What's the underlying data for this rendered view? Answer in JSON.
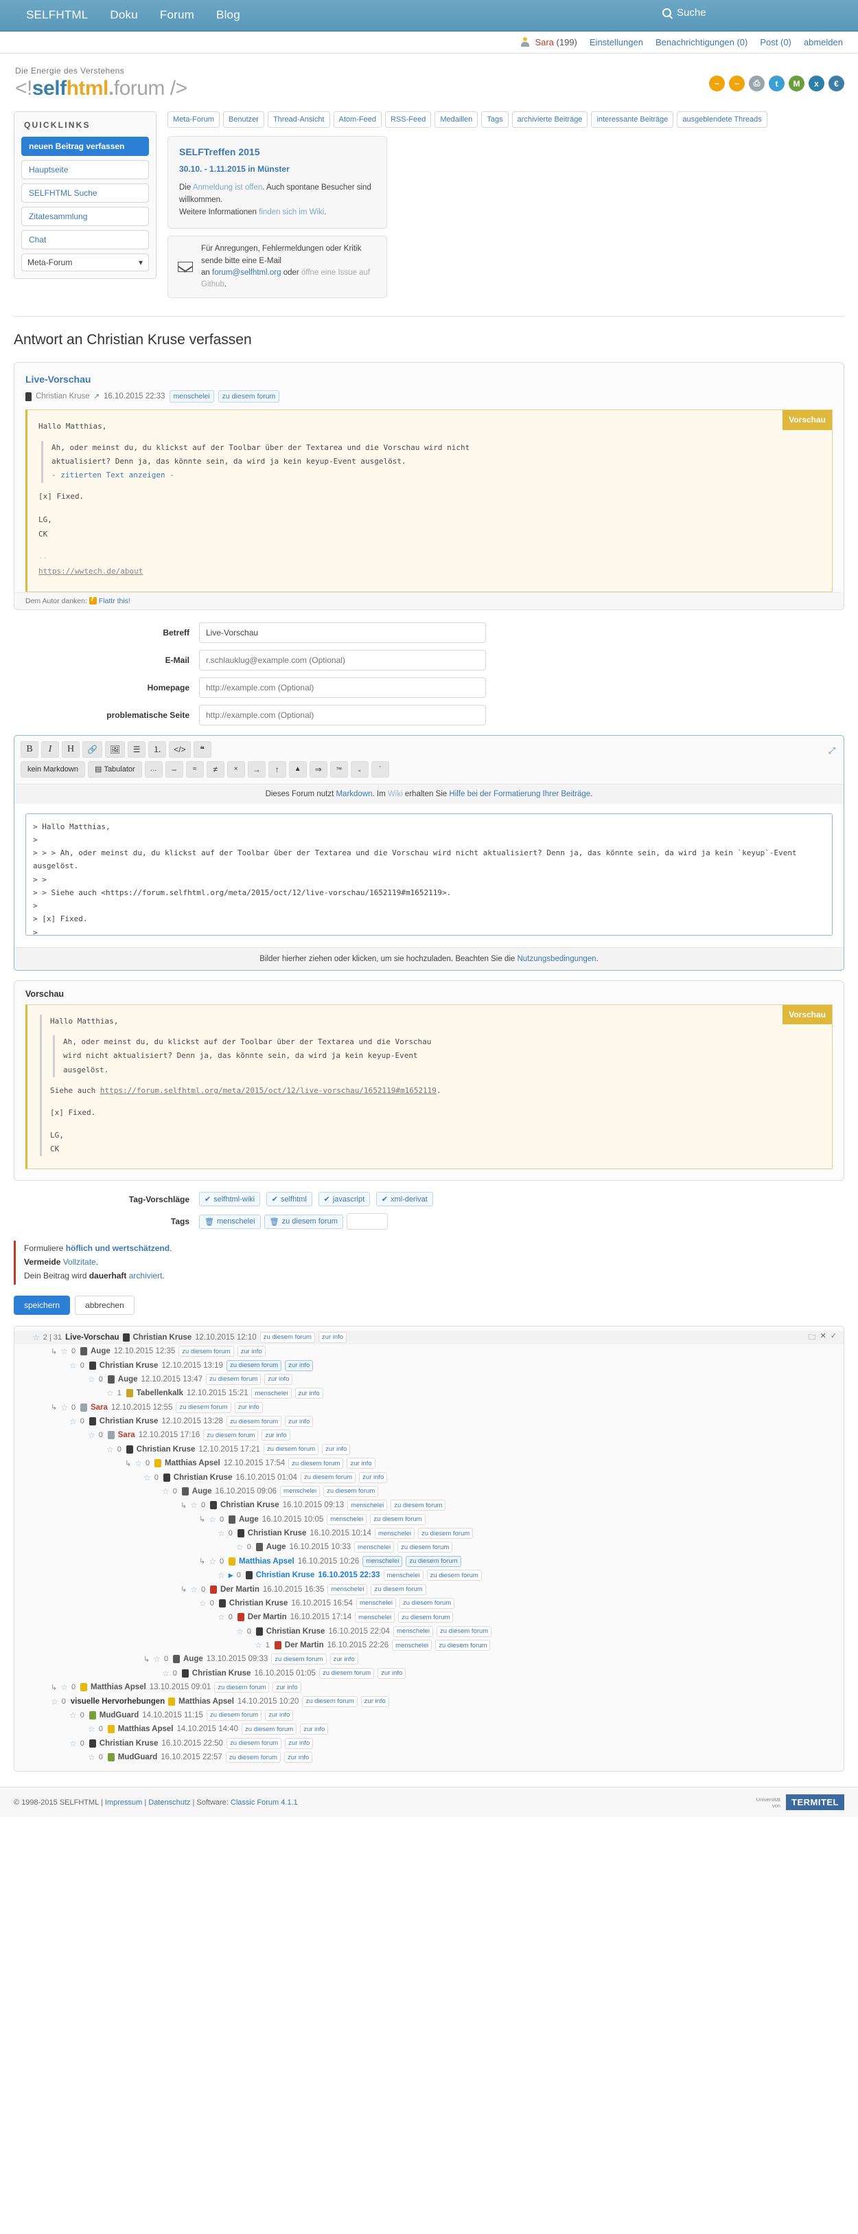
{
  "topnav": {
    "items": [
      "SELFHTML",
      "Doku",
      "Forum",
      "Blog"
    ],
    "search_label": "Suche",
    "search_icon": "search-icon"
  },
  "userbar": {
    "user_name": "Sara",
    "user_count": "(199)",
    "links": [
      "Einstellungen",
      "Benachrichtigungen (0)",
      "Post (0)",
      "abmelden"
    ]
  },
  "brand": {
    "tagline": "Die Energie des Verstehens",
    "logo_open": "<!",
    "logo_self": "self",
    "logo_html": "html",
    "logo_dot": ".",
    "logo_forum": "forum />",
    "social_icons": [
      "rss-icon",
      "rss-alt-icon",
      "print-icon",
      "twitter-icon",
      "mastodon-icon",
      "xing-icon",
      "euro-icon"
    ],
    "colors": {
      "self": "#3c7ea6",
      "html": "#e8a92b",
      "accent": "#2b7fd4"
    }
  },
  "sidebar": {
    "title": "QUICKLINKS",
    "primary": "neuen Beitrag verfassen",
    "items": [
      "Hauptseite",
      "SELFHTML Suche",
      "Zitatesammlung",
      "Chat"
    ],
    "select_value": "Meta-Forum"
  },
  "forum_tabs": [
    "Meta-Forum",
    "Benutzer",
    "Thread-Ansicht",
    "Atom-Feed",
    "RSS-Feed",
    "Medaillen",
    "Tags",
    "archivierte Beiträge",
    "interessante Beiträge",
    "ausgeblendete Threads"
  ],
  "notice": {
    "title": "SELFTreffen 2015",
    "when": "30.10. - 1.11.2015 in Münster",
    "line1_a": "Die ",
    "line1_link": "Anmeldung ist offen",
    "line1_b": ". Auch spontane Besucher sind willkommen.",
    "line2_a": "Weitere Informationen ",
    "line2_link": "finden sich im Wiki",
    "line2_b": "."
  },
  "mailbox": {
    "icon": "envelope-icon",
    "line1": "Für Anregungen, Fehlermeldungen oder Kritik sende bitte eine E-Mail",
    "line2_a": "an ",
    "line2_mail": "forum@selfhtml.org",
    "line2_b": " oder ",
    "line2_link": "öffne eine Issue auf Github",
    "line2_c": "."
  },
  "reply": {
    "heading": "Antwort an Christian Kruse verfassen"
  },
  "quoted_post": {
    "subject": "Live-Vorschau",
    "author": "Christian Kruse",
    "author_icon": "avatar-icon",
    "external_icon": "external-link-icon",
    "timestamp": "16.10.2015 22:33",
    "tags": [
      "menschelei",
      "zu diesem forum"
    ],
    "badge": "Vorschau",
    "greeting": "Hallo Matthias,",
    "quote_l1": "Ah, oder meinst du, du klickst auf der Toolbar über der Textarea und die Vorschau wird nicht",
    "quote_l2": "aktualisiert? Denn ja, das könnte sein, da wird ja kein keyup-Event ausgelöst.",
    "quote_toggle": "- zitierten Text anzeigen -",
    "fixed": "[x] Fixed.",
    "sig1": "LG,",
    "sig2": "CK",
    "sig_dash": "--",
    "sig_url": "https://wwtech.de/about",
    "thanks_label": "Dem Autor danken:",
    "flattr_icon": "flattr-icon",
    "flattr_label": "Flattr this!"
  },
  "form": {
    "rows": [
      {
        "label": "Betreff",
        "value": "Live-Vorschau",
        "placeholder": ""
      },
      {
        "label": "E-Mail",
        "value": "",
        "placeholder": "r.schlauklug@example.com (Optional)"
      },
      {
        "label": "Homepage",
        "value": "",
        "placeholder": "http://example.com (Optional)"
      },
      {
        "label": "problematische Seite",
        "value": "",
        "placeholder": "http://example.com (Optional)"
      }
    ]
  },
  "toolbar": {
    "row1": [
      {
        "glyph": "B",
        "name": "bold-button"
      },
      {
        "glyph": "I",
        "name": "italic-button"
      },
      {
        "glyph": "H",
        "name": "heading-button"
      },
      {
        "glyph": "🔗",
        "name": "link-button"
      },
      {
        "glyph": "🖼",
        "name": "image-button"
      },
      {
        "glyph": "☰",
        "name": "unordered-list-button"
      },
      {
        "glyph": "⒈",
        "name": "ordered-list-button"
      },
      {
        "glyph": "</>",
        "name": "code-button"
      },
      {
        "glyph": "❝",
        "name": "quote-button"
      }
    ],
    "row2": [
      {
        "glyph": "kein Markdown",
        "name": "no-markdown-button",
        "wide": true
      },
      {
        "glyph": "Tabulator",
        "name": "tabulator-button",
        "wide": true
      },
      {
        "glyph": "…",
        "name": "ellipsis-button"
      },
      {
        "glyph": "–",
        "name": "endash-button"
      },
      {
        "glyph": "≈",
        "name": "approx-button"
      },
      {
        "glyph": "≠",
        "name": "notequal-button"
      },
      {
        "glyph": "×",
        "name": "times-button"
      },
      {
        "glyph": "→",
        "name": "arrow-right-button"
      },
      {
        "glyph": "↑",
        "name": "arrow-up-button"
      },
      {
        "glyph": "▲",
        "name": "triangle-up-button"
      },
      {
        "glyph": "⇒",
        "name": "double-arrow-button"
      },
      {
        "glyph": "™",
        "name": "trademark-button"
      },
      {
        "glyph": "„",
        "name": "quote-low-button"
      },
      {
        "glyph": "’",
        "name": "apostrophe-button"
      }
    ],
    "expand_icon": "expand-icon",
    "markdown_note_a": "Dieses Forum nutzt ",
    "markdown_note_link1": "Markdown",
    "markdown_note_b": ". Im ",
    "markdown_note_link2": "Wiki",
    "markdown_note_c": " erhalten Sie ",
    "markdown_note_link3": "Hilfe bei der Formatierung Ihrer Beiträge",
    "markdown_note_d": "."
  },
  "textarea": {
    "value": "> Hallo Matthias,\n>\n> > > Ah, oder meinst du, du klickst auf der Toolbar über der Textarea und die Vorschau wird nicht aktualisiert? Denn ja, das könnte sein, da wird ja kein `keyup`-Event ausgelöst.\n> >\n> > Siehe auch <https://forum.selfhtml.org/meta/2015/oct/12/live-vorschau/1652119#m1652119>.\n>\n> [x] Fixed.\n>\n> LG,\n> CK\n>"
  },
  "dropzone": {
    "text_a": "Bilder hierher ziehen oder klicken, um sie hochzuladen. Beachten Sie die ",
    "link": "Nutzungsbedingungen",
    "text_b": "."
  },
  "preview": {
    "title": "Vorschau",
    "badge": "Vorschau",
    "greeting": "Hallo Matthias,",
    "quote_l1": "Ah, oder meinst du, du klickst auf der Toolbar über der Textarea und die Vorschau",
    "quote_l2": "wird nicht aktualisiert? Denn ja, das könnte sein, da wird ja kein keyup-Event",
    "quote_l3": "ausgelöst.",
    "quote_code": "keyup",
    "siehe_a": "Siehe auch ",
    "siehe_url": "https://forum.selfhtml.org/meta/2015/oct/12/live-vorschau/1652119#m1652119",
    "siehe_b": ".",
    "fixed": "[x] Fixed.",
    "sig1": "LG,",
    "sig2": "CK"
  },
  "tags_section": {
    "suggestions_label": "Tag-Vorschläge",
    "suggestions": [
      "selfhtml-wiki",
      "selfhtml",
      "javascript",
      "xml-derivat"
    ],
    "tags_label": "Tags",
    "tags": [
      "menschelei",
      "zu diesem forum"
    ],
    "new_tag_value": ""
  },
  "hints": {
    "l1_a": "Formuliere ",
    "l1_b": "höflich und wertschätzend",
    "l1_c": ".",
    "l2_a": "Vermeide ",
    "l2_b": "Vollzitate",
    "l2_c": ".",
    "l3_a": "Dein Beitrag wird ",
    "l3_b": "dauerhaft ",
    "l3_c": "archiviert",
    "l3_d": "."
  },
  "actions": {
    "save": "speichern",
    "cancel": "abbrechen"
  },
  "tree": {
    "controls": [
      "folder-icon",
      "close-icon",
      "check-icon"
    ],
    "rows": [
      {
        "indent": 0,
        "arrow": false,
        "star": "☆",
        "count": "2 | 31",
        "subject": "Live-Vorschau",
        "avatar": "av-ck",
        "author": "Christian Kruse",
        "time": "12.10.2015 12:10",
        "tags": [
          "zu diesem forum",
          "zur info"
        ],
        "head": true
      },
      {
        "indent": 1,
        "arrow": true,
        "star": "☆",
        "count": "0",
        "avatar": "av-auge",
        "author": "Auge",
        "time": "12.10.2015 12:35",
        "tags": [
          "zu diesem forum",
          "zur info"
        ]
      },
      {
        "indent": 2,
        "arrow": false,
        "star": "☆",
        "count": "0",
        "avatar": "av-ck",
        "author": "Christian Kruse",
        "time": "12.10.2015 13:19",
        "tags": [
          "zu diesem forum",
          "zur info"
        ],
        "hl": true
      },
      {
        "indent": 3,
        "arrow": false,
        "star": "☆",
        "count": "0",
        "avatar": "av-auge",
        "author": "Auge",
        "time": "12.10.2015 13:47",
        "tags": [
          "zu diesem forum",
          "zur info"
        ]
      },
      {
        "indent": 4,
        "arrow": false,
        "star": "☆",
        "count": "1",
        "avatar": "av-tab",
        "author": "Tabellenkalk",
        "time": "12.10.2015 15:21",
        "tags": [
          "menschelei",
          "zur info"
        ]
      },
      {
        "indent": 1,
        "arrow": true,
        "star": "☆",
        "count": "0",
        "avatar": "av-sara",
        "author": "Sara",
        "author_class": "sara",
        "time": "12.10.2015 12:55",
        "tags": [
          "zu diesem forum",
          "zur info"
        ]
      },
      {
        "indent": 2,
        "arrow": false,
        "star": "☆",
        "count": "0",
        "avatar": "av-ck",
        "author": "Christian Kruse",
        "time": "12.10.2015 13:28",
        "tags": [
          "zu diesem forum",
          "zur info"
        ]
      },
      {
        "indent": 3,
        "arrow": false,
        "star": "☆",
        "count": "0",
        "avatar": "av-sara",
        "author": "Sara",
        "author_class": "sara",
        "time": "12.10.2015 17:16",
        "tags": [
          "zu diesem forum",
          "zur info"
        ]
      },
      {
        "indent": 4,
        "arrow": false,
        "star": "☆",
        "count": "0",
        "avatar": "av-ck",
        "author": "Christian Kruse",
        "time": "12.10.2015 17:21",
        "tags": [
          "zu diesem forum",
          "zur info"
        ]
      },
      {
        "indent": 5,
        "arrow": true,
        "star": "☆",
        "count": "0",
        "avatar": "av-ma",
        "author": "Matthias Apsel",
        "time": "12.10.2015 17:54",
        "tags": [
          "zu diesem forum",
          "zur info"
        ]
      },
      {
        "indent": 6,
        "arrow": false,
        "star": "☆",
        "count": "0",
        "avatar": "av-ck",
        "author": "Christian Kruse",
        "time": "16.10.2015 01:04",
        "tags": [
          "zu diesem forum",
          "zur info"
        ]
      },
      {
        "indent": 7,
        "arrow": false,
        "star": "☆",
        "count": "0",
        "avatar": "av-auge",
        "author": "Auge",
        "time": "16.10.2015 09:06",
        "tags": [
          "menschelei",
          "zu diesem forum"
        ]
      },
      {
        "indent": 8,
        "arrow": true,
        "star": "☆",
        "count": "0",
        "avatar": "av-ck",
        "author": "Christian Kruse",
        "time": "16.10.2015 09:13",
        "tags": [
          "menschelei",
          "zu diesem forum"
        ]
      },
      {
        "indent": 9,
        "arrow": true,
        "star": "☆",
        "count": "0",
        "avatar": "av-auge",
        "author": "Auge",
        "time": "16.10.2015 10:05",
        "tags": [
          "menschelei",
          "zu diesem forum"
        ]
      },
      {
        "indent": 10,
        "arrow": false,
        "star": "☆",
        "count": "0",
        "avatar": "av-ck",
        "author": "Christian Kruse",
        "time": "16.10.2015 10:14",
        "tags": [
          "menschelei",
          "zu diesem forum"
        ]
      },
      {
        "indent": 11,
        "arrow": false,
        "star": "☆",
        "count": "0",
        "avatar": "av-auge",
        "author": "Auge",
        "time": "16.10.2015 10:33",
        "tags": [
          "menschelei",
          "zu diesem forum"
        ]
      },
      {
        "indent": 9,
        "arrow": true,
        "star": "☆",
        "count": "0",
        "avatar": "av-ma",
        "author": "Matthias Apsel",
        "author_class": "cur",
        "time": "16.10.2015 10:26",
        "tags": [
          "menschelei",
          "zu diesem forum"
        ],
        "hl": true
      },
      {
        "indent": 10,
        "arrow": false,
        "star": "☆",
        "tri": true,
        "count": "0",
        "avatar": "av-ck",
        "author": "Christian Kruse",
        "author_class": "cur",
        "time": "16.10.2015 22:33",
        "time_class": "cur",
        "tags": [
          "menschelei",
          "zu diesem forum"
        ]
      },
      {
        "indent": 8,
        "arrow": true,
        "star": "☆",
        "count": "0",
        "avatar": "av-dm",
        "author": "Der Martin",
        "time": "16.10.2015 16:35",
        "tags": [
          "menschelei",
          "zu diesem forum"
        ]
      },
      {
        "indent": 9,
        "arrow": false,
        "star": "☆",
        "count": "0",
        "avatar": "av-ck",
        "author": "Christian Kruse",
        "time": "16.10.2015 16:54",
        "tags": [
          "menschelei",
          "zu diesem forum"
        ]
      },
      {
        "indent": 10,
        "arrow": false,
        "star": "☆",
        "count": "0",
        "avatar": "av-dm",
        "author": "Der Martin",
        "time": "16.10.2015 17:14",
        "tags": [
          "menschelei",
          "zu diesem forum"
        ]
      },
      {
        "indent": 11,
        "arrow": false,
        "star": "☆",
        "count": "0",
        "avatar": "av-ck",
        "author": "Christian Kruse",
        "time": "16.10.2015 22:04",
        "tags": [
          "menschelei",
          "zu diesem forum"
        ]
      },
      {
        "indent": 12,
        "arrow": false,
        "star": "☆",
        "count": "1",
        "avatar": "av-dm",
        "author": "Der Martin",
        "time": "16.10.2015 22:26",
        "tags": [
          "menschelei",
          "zu diesem forum"
        ]
      },
      {
        "indent": 6,
        "arrow": true,
        "star": "☆",
        "count": "0",
        "avatar": "av-auge",
        "author": "Auge",
        "time": "13.10.2015 09:33",
        "tags": [
          "zu diesem forum",
          "zur info"
        ]
      },
      {
        "indent": 7,
        "arrow": false,
        "star": "☆",
        "count": "0",
        "avatar": "av-ck",
        "author": "Christian Kruse",
        "time": "16.10.2015 01:05",
        "tags": [
          "zu diesem forum",
          "zur info"
        ]
      },
      {
        "indent": 1,
        "arrow": true,
        "star": "☆",
        "count": "0",
        "avatar": "av-ma",
        "author": "Matthias Apsel",
        "time": "13.10.2015 09:01",
        "tags": [
          "zu diesem forum",
          "zur info"
        ]
      },
      {
        "indent": 1,
        "arrow": false,
        "star": "☆",
        "count": "0",
        "subject": "visuelle Hervorhebungen",
        "avatar": "av-ma",
        "author": "Matthias Apsel",
        "time": "14.10.2015 10:20",
        "tags": [
          "zu diesem forum",
          "zur info"
        ]
      },
      {
        "indent": 2,
        "arrow": false,
        "star": "☆",
        "count": "0",
        "avatar": "av-mg",
        "author": "MudGuard",
        "time": "14.10.2015 11:15",
        "tags": [
          "zu diesem forum",
          "zur info"
        ]
      },
      {
        "indent": 3,
        "arrow": false,
        "star": "☆",
        "count": "0",
        "avatar": "av-ma",
        "author": "Matthias Apsel",
        "time": "14.10.2015 14:40",
        "tags": [
          "zu diesem forum",
          "zur info"
        ]
      },
      {
        "indent": 2,
        "arrow": false,
        "star": "☆",
        "count": "0",
        "avatar": "av-ck",
        "author": "Christian Kruse",
        "time": "16.10.2015 22:50",
        "tags": [
          "zu diesem forum",
          "zur info"
        ]
      },
      {
        "indent": 3,
        "arrow": false,
        "star": "☆",
        "count": "0",
        "avatar": "av-mg",
        "author": "MudGuard",
        "time": "16.10.2015 22:57",
        "tags": [
          "zu diesem forum",
          "zur info"
        ]
      }
    ]
  },
  "footer": {
    "copyright": "© 1998-2015 SELFHTML",
    "links": [
      "Impressum",
      "Datenschutz"
    ],
    "software_label": "Software:",
    "software_link": "Classic Forum 4.1.1",
    "sponsor_uni": "Universität\nvon",
    "sponsor_name": "TERMITEL"
  }
}
